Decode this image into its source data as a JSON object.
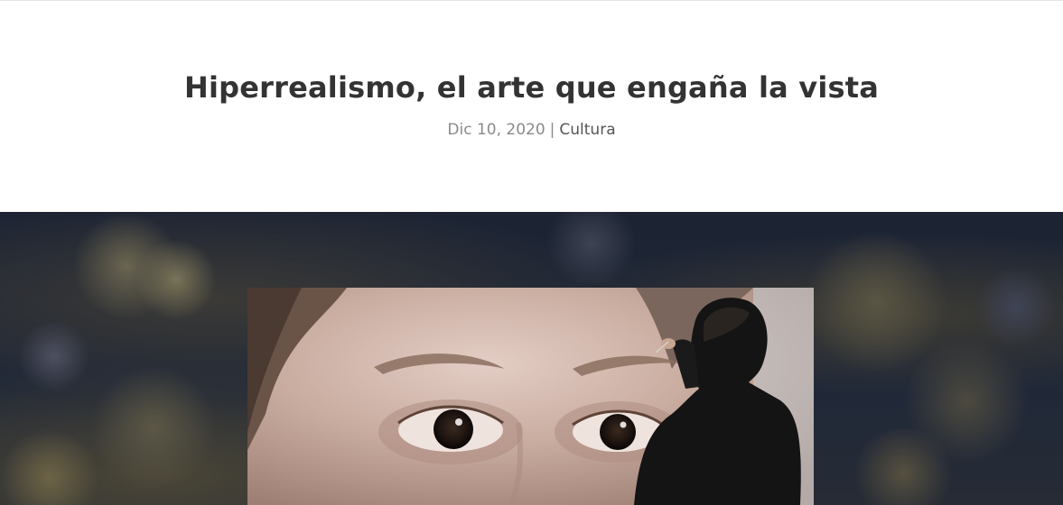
{
  "post": {
    "title": "Hiperrealismo, el arte que engaña la vista",
    "date": "Dic 10, 2020",
    "separator": "|",
    "category": "Cultura"
  },
  "hero": {
    "image_alt": "Hyperrealistic painting of a child's face with an artist painting it",
    "colors": {
      "background": "#1f2636",
      "painting_skin": "#c8ab9f"
    }
  }
}
